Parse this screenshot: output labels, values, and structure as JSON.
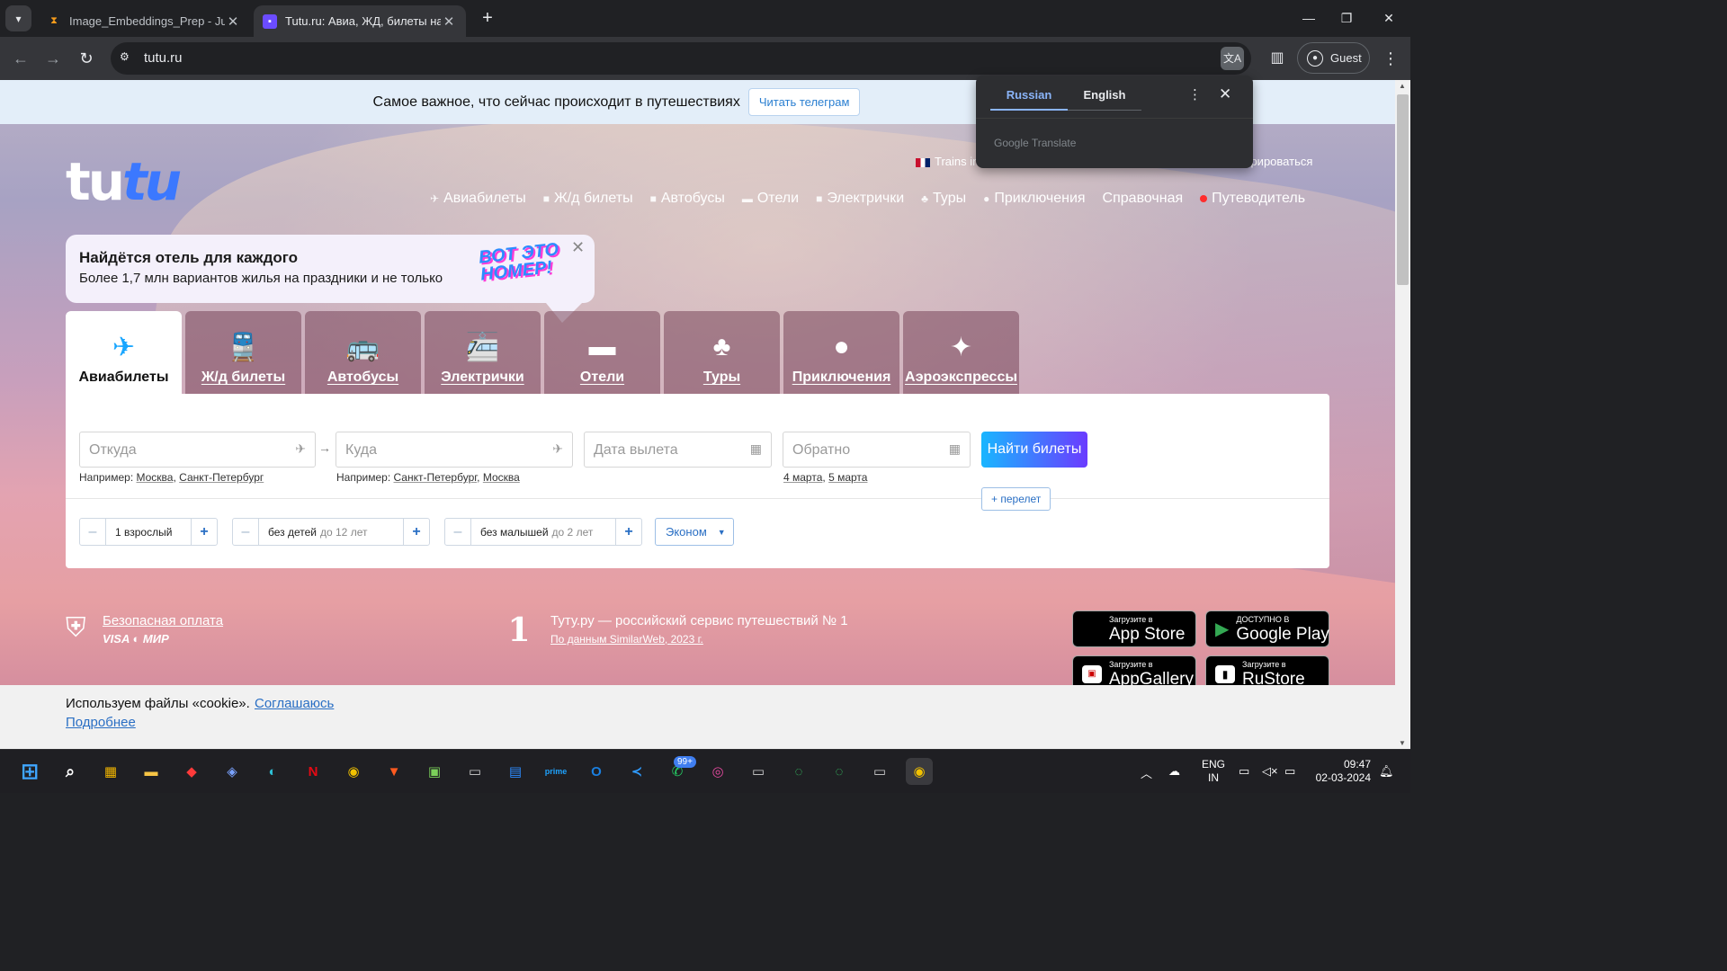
{
  "browser": {
    "tabs": [
      {
        "title": "Image_Embeddings_Prep - Jupy",
        "favicon": "hourglass-icon",
        "active": false
      },
      {
        "title": "Tutu.ru: Авиа, ЖД, билеты на а",
        "favicon": "tutu-icon",
        "active": true
      }
    ],
    "new_tab": "+",
    "url": "tutu.ru",
    "profile_label": "Guest"
  },
  "translate_popup": {
    "source_lang": "Russian",
    "target_lang": "English",
    "provider": "Google Translate"
  },
  "page": {
    "promo_banner": {
      "text": "Самое важное, что сейчас происходит в путешествиях",
      "button": "Читать телеграм"
    },
    "logo": {
      "part1": "tu",
      "part2": "tu"
    },
    "top_links": {
      "trains_in": "Trains in",
      "register": "стрироваться"
    },
    "nav": [
      {
        "label": "Авиабилеты",
        "icon": "plane-icon"
      },
      {
        "label": "Ж/д билеты",
        "icon": "train-icon"
      },
      {
        "label": "Автобусы",
        "icon": "bus-icon"
      },
      {
        "label": "Отели",
        "icon": "bed-icon"
      },
      {
        "label": "Электрички",
        "icon": "commuter-train-icon"
      },
      {
        "label": "Туры",
        "icon": "palm-icon"
      },
      {
        "label": "Приключения",
        "icon": "balloon-icon"
      },
      {
        "label": "Справочная",
        "icon": ""
      },
      {
        "label": "Путеводитель",
        "icon": "red-dot"
      }
    ],
    "hotel_promo": {
      "title": "Найдётся отель для каждого",
      "subtitle": "Более 1,7 млн вариантов жилья на праздники и не только",
      "badge": "ВОТ ЭТО НОМЕР!",
      "close": "✕"
    },
    "services": [
      {
        "label": "Авиабилеты",
        "icon": "plane-icon",
        "active": true
      },
      {
        "label": "Ж/д билеты",
        "icon": "train-icon",
        "active": false
      },
      {
        "label": "Автобусы",
        "icon": "bus-icon",
        "active": false
      },
      {
        "label": "Электрички",
        "icon": "commuter-train-icon",
        "active": false
      },
      {
        "label": "Отели",
        "icon": "bed-icon",
        "active": false
      },
      {
        "label": "Туры",
        "icon": "palm-icon",
        "active": false
      },
      {
        "label": "Приключения",
        "icon": "balloon-icon",
        "active": false
      },
      {
        "label": "Аэроэкспрессы",
        "icon": "aeroexpress-icon",
        "active": false
      }
    ],
    "search": {
      "from": {
        "placeholder": "Откуда",
        "hint_prefix": "Например:",
        "hint_1": "Москва",
        "hint_2": "Санкт-Петербург"
      },
      "to": {
        "placeholder": "Куда",
        "hint_prefix": "Например:",
        "hint_1": "Санкт-Петербург",
        "hint_2": "Москва"
      },
      "depart": {
        "placeholder": "Дата вылета"
      },
      "return": {
        "placeholder": "Обратно",
        "hint_1": "4 марта",
        "hint_2": "5 марта"
      },
      "find_button": "Найти билеты",
      "add_flight": "+ перелет",
      "adults": "1 взрослый",
      "children": "без детей",
      "children_sub": "до 12 лет",
      "infants": "без малышей",
      "infants_sub": "до 2 лет",
      "class": "Эконом",
      "minus": "–",
      "plus": "+"
    },
    "trust": {
      "payment_title": "Безопасная оплата",
      "payment_logos": "VISA ◐ МИР",
      "rank_number": "1",
      "rank_title": "Туту.ру — российский сервис путешествий № 1",
      "rank_source": "По данным SimilarWeb, 2023 г."
    },
    "stores": [
      {
        "small": "Загрузите в",
        "big": "App Store",
        "icon": "apple-icon"
      },
      {
        "small": "ДОСТУПНО В",
        "big": "Google Play",
        "icon": "google-play-icon"
      },
      {
        "small": "Загрузите в",
        "big": "AppGallery",
        "icon": "huawei-icon"
      },
      {
        "small": "Загрузите в",
        "big": "RuStore",
        "icon": "rustore-icon"
      }
    ],
    "cookie": {
      "message": "Используем файлы «cookie».",
      "agree": "Соглашаюсь",
      "more": "Подробнее"
    }
  },
  "taskbar": {
    "badge": "99+",
    "lang_1": "ENG",
    "lang_2": "IN",
    "time": "09:47",
    "date": "02-03-2024"
  }
}
